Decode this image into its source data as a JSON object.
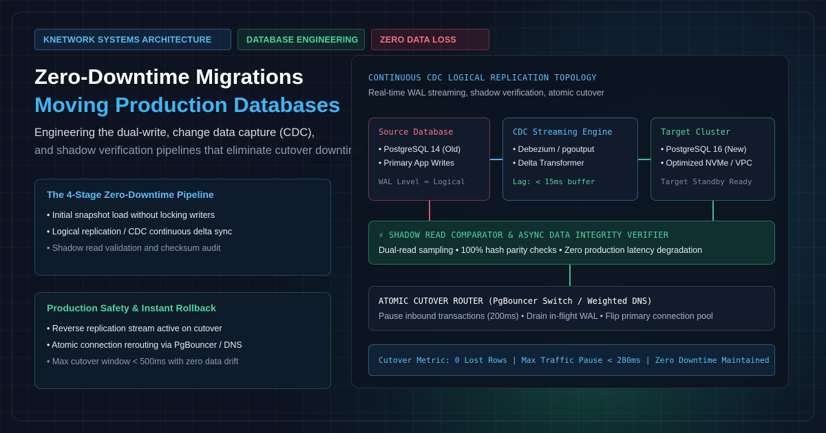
{
  "tags": {
    "architecture": "KNETWORK SYSTEMS ARCHITECTURE",
    "engineering": "DATABASE ENGINEERING",
    "zero_loss": "ZERO DATA LOSS"
  },
  "hero": {
    "title_line1": "Zero-Downtime Migrations",
    "title_line2": "Moving Production Databases",
    "subtitle_line1": "Engineering the dual-write, change data capture (CDC),",
    "subtitle_line2": "and shadow verification pipelines that eliminate cutover downtime."
  },
  "pipeline_card": {
    "title": "The 4-Stage Zero-Downtime Pipeline",
    "items": [
      "• Initial snapshot load without locking writers",
      "• Logical replication / CDC continuous delta sync",
      "• Shadow read validation and checksum audit"
    ]
  },
  "safety_card": {
    "title": "Production Safety & Instant Rollback",
    "items": [
      "• Reverse replication stream active on cutover",
      "• Atomic connection rerouting via PgBouncer / DNS",
      "• Max cutover window < 500ms with zero data drift"
    ]
  },
  "topology": {
    "title": "CONTINUOUS CDC LOGICAL REPLICATION TOPOLOGY",
    "subtitle": "Real-time WAL streaming, shadow verification, atomic cutover",
    "source": {
      "title": "Source Database",
      "lines": [
        "• PostgreSQL 14 (Old)",
        "• Primary App Writes"
      ],
      "footer": "WAL Level = Logical"
    },
    "cdc": {
      "title": "CDC Streaming Engine",
      "lines": [
        "• Debezium / pgoutput",
        "• Delta Transformer"
      ],
      "footer": "Lag: < 15ms buffer"
    },
    "target": {
      "title": "Target Cluster",
      "lines": [
        "• PostgreSQL 16 (New)",
        "• Optimized NVMe / VPC"
      ],
      "footer": "Target Standby Ready"
    },
    "shadow": {
      "title": "⚡ SHADOW READ COMPARATOR & ASYNC DATA INTEGRITY VERIFIER",
      "description": "Dual-read sampling • 100% hash parity checks • Zero production latency degradation"
    },
    "router": {
      "title": "ATOMIC CUTOVER ROUTER (PgBouncer Switch / Weighted DNS)",
      "description": "Pause inbound transactions (200ms) • Drain in-flight WAL • Flip primary connection pool"
    },
    "metric": "Cutover Metric: 0 Lost Rows | Max Traffic Pause < 280ms | Zero Downtime Maintained"
  },
  "colors": {
    "background": "#0d1320",
    "accent_blue": "#3fb4f2",
    "accent_green": "#4fd39a",
    "accent_red": "#f27083"
  }
}
